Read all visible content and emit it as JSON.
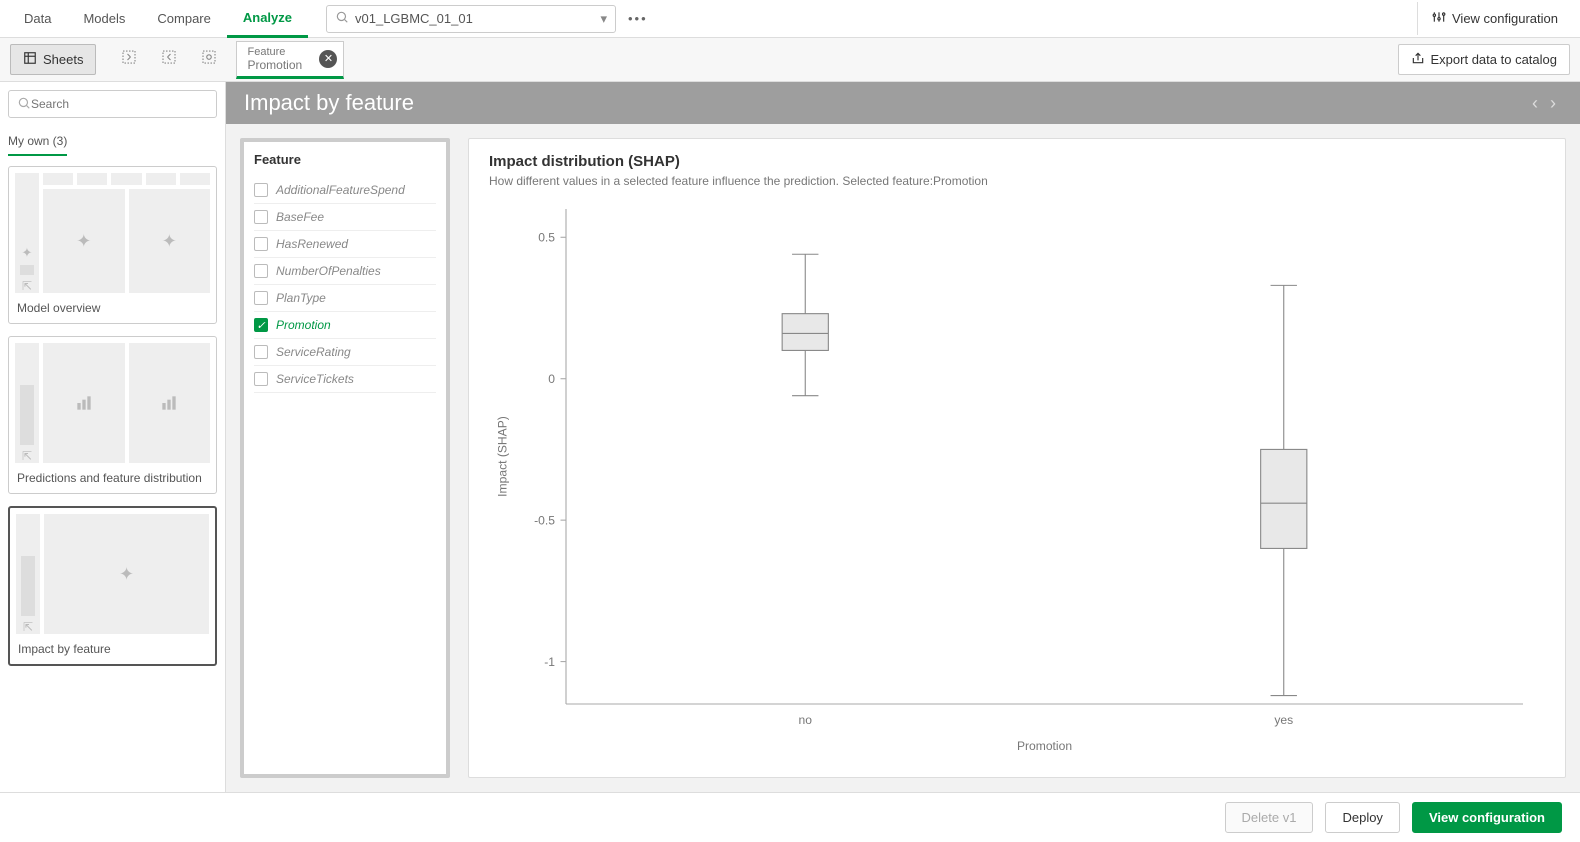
{
  "topnav": {
    "tabs": [
      "Data",
      "Models",
      "Compare",
      "Analyze"
    ],
    "active": "Analyze",
    "search_value": "v01_LGBMC_01_01",
    "viewcfg_label": "View configuration"
  },
  "belowbar": {
    "sheets_label": "Sheets",
    "chip_label": "Feature",
    "chip_value": "Promotion",
    "export_label": "Export data to catalog"
  },
  "leftbar": {
    "search_placeholder": "Search",
    "subtab": "My own (3)",
    "cards": [
      {
        "title": "Model overview"
      },
      {
        "title": "Predictions and feature distribution"
      },
      {
        "title": "Impact by feature"
      }
    ]
  },
  "page": {
    "header": "Impact by feature",
    "feature_panel_title": "Feature",
    "features": [
      {
        "name": "AdditionalFeatureSpend",
        "checked": false
      },
      {
        "name": "BaseFee",
        "checked": false
      },
      {
        "name": "HasRenewed",
        "checked": false
      },
      {
        "name": "NumberOfPenalties",
        "checked": false
      },
      {
        "name": "PlanType",
        "checked": false
      },
      {
        "name": "Promotion",
        "checked": true
      },
      {
        "name": "ServiceRating",
        "checked": false
      },
      {
        "name": "ServiceTickets",
        "checked": false
      }
    ],
    "chart_title": "Impact distribution (SHAP)",
    "chart_subtitle": "How different values in a selected feature influence the prediction. Selected feature:Promotion"
  },
  "chart_data": {
    "type": "boxplot",
    "title": "Impact distribution (SHAP)",
    "xlabel": "Promotion",
    "ylabel": "Impact (SHAP)",
    "ylim": [
      -1.15,
      0.6
    ],
    "yticks": [
      -1,
      -0.5,
      0,
      0.5
    ],
    "categories": [
      "no",
      "yes"
    ],
    "series": [
      {
        "name": "no",
        "min": -0.06,
        "q1": 0.1,
        "median": 0.16,
        "q3": 0.23,
        "max": 0.44
      },
      {
        "name": "yes",
        "min": -1.12,
        "q1": -0.6,
        "median": -0.44,
        "q3": -0.25,
        "max": 0.33
      }
    ]
  },
  "footer": {
    "delete_label": "Delete v1",
    "deploy_label": "Deploy",
    "viewcfg_label": "View configuration"
  }
}
